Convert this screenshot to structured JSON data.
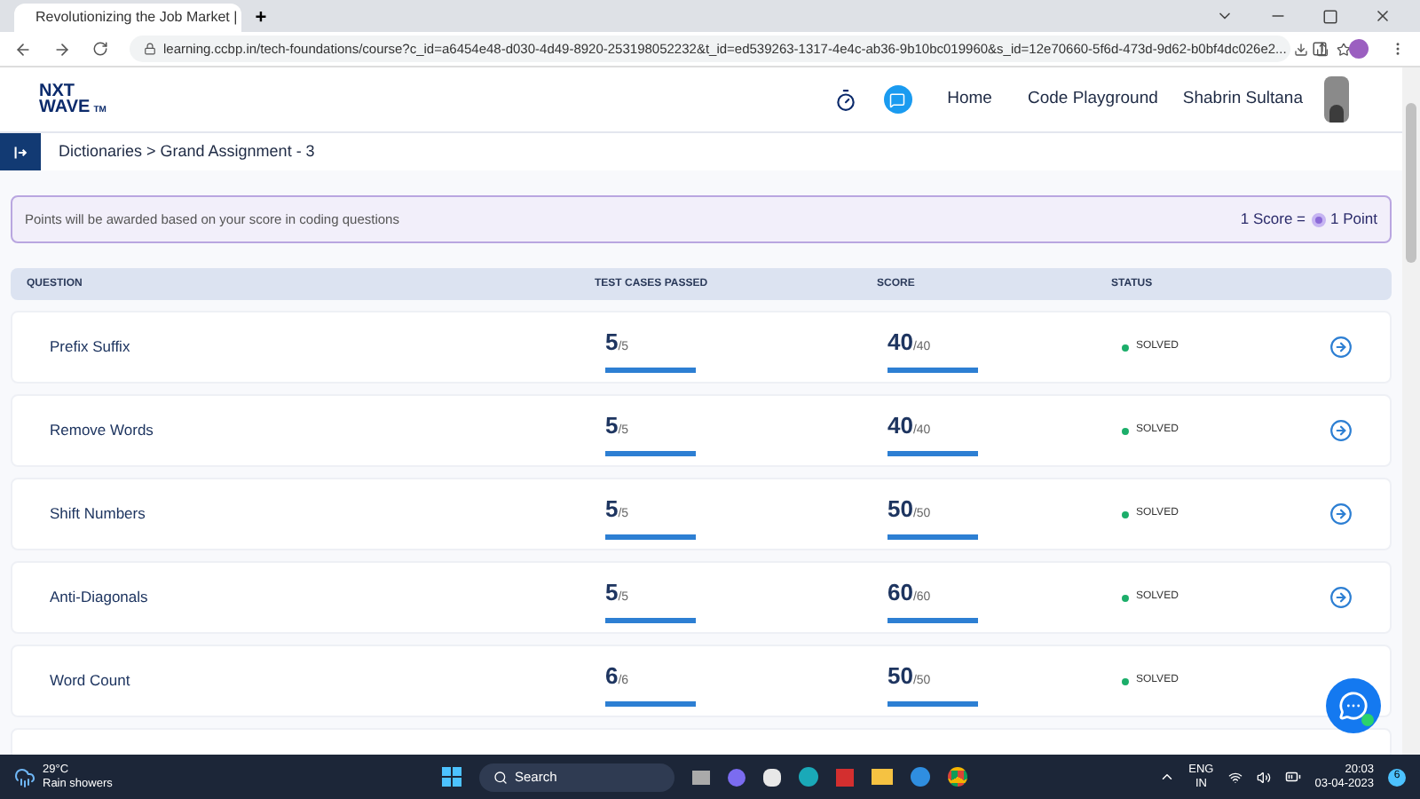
{
  "browser": {
    "tab_title": "Revolutionizing the Job Market |",
    "new_tab": "+",
    "url": "learning.ccbp.in/tech-foundations/course?c_id=a6454e48-d030-4d49-8920-253198052232&t_id=ed539263-1317-4e4c-ab36-9b10bc019960&s_id=12e70660-5f6d-473d-9d62-b0bf4dc026e2..."
  },
  "header": {
    "logo_top": "NXT",
    "logo_bottom": "WAVE",
    "logo_tm": "TM",
    "nav": [
      "Home",
      "Code Playground"
    ],
    "user": "Shabrin Sultana"
  },
  "breadcrumb": "Dictionaries > Grand Assignment - 3",
  "banner": {
    "text": "Points will be awarded based on your score in coding questions",
    "score_left": "1 Score =",
    "score_right": "1 Point"
  },
  "table": {
    "columns": [
      "QUESTION",
      "TEST CASES PASSED",
      "SCORE",
      "STATUS"
    ],
    "rows": [
      {
        "question": "Prefix Suffix",
        "tests": {
          "passed": "5",
          "total": "/5",
          "level": 1
        },
        "score": {
          "value": "40",
          "max": "/40",
          "level": 1
        },
        "status": "SOLVED"
      },
      {
        "question": "Remove Words",
        "tests": {
          "passed": "5",
          "total": "/5",
          "level": 1
        },
        "score": {
          "value": "40",
          "max": "/40",
          "level": 1
        },
        "status": "SOLVED"
      },
      {
        "question": "Shift Numbers",
        "tests": {
          "passed": "5",
          "total": "/5",
          "level": 1
        },
        "score": {
          "value": "50",
          "max": "/50",
          "level": 1
        },
        "status": "SOLVED"
      },
      {
        "question": "Anti-Diagonals",
        "tests": {
          "passed": "5",
          "total": "/5",
          "level": 1
        },
        "score": {
          "value": "60",
          "max": "/60",
          "level": 1
        },
        "status": "SOLVED"
      },
      {
        "question": "Word Count",
        "tests": {
          "passed": "6",
          "total": "/6",
          "level": 1
        },
        "score": {
          "value": "50",
          "max": "/50",
          "level": 1
        },
        "status": "SOLVED"
      }
    ]
  },
  "taskbar": {
    "temperature": "29°C",
    "weather": "Rain showers",
    "search": "Search",
    "lang_top": "ENG",
    "lang_bottom": "IN",
    "time": "20:03",
    "date": "03-04-2023",
    "notifications": "6"
  }
}
